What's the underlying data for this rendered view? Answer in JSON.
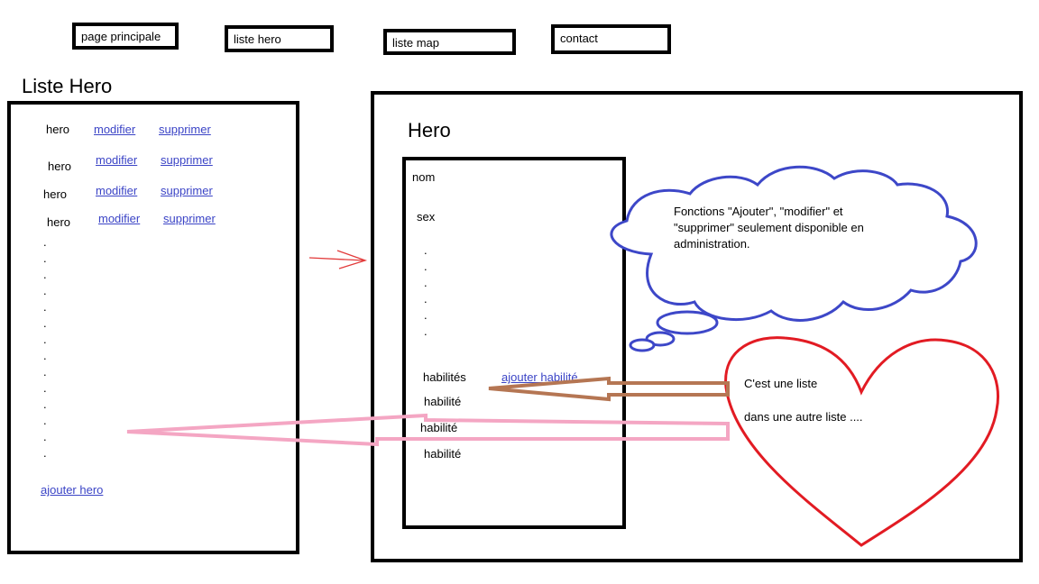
{
  "nav": [
    {
      "label": "page principale"
    },
    {
      "label": "liste hero"
    },
    {
      "label": "liste map"
    },
    {
      "label": "contact"
    }
  ],
  "left": {
    "title": "Liste Hero",
    "rows": [
      {
        "name": "hero",
        "edit": "modifier",
        "del": "supprimer"
      },
      {
        "name": "hero",
        "edit": "modifier",
        "del": "supprimer"
      },
      {
        "name": "hero",
        "edit": "modifier",
        "del": "supprimer"
      },
      {
        "name": "hero",
        "edit": "modifier",
        "del": "supprimer"
      }
    ],
    "add_link": "ajouter hero"
  },
  "right": {
    "title": "Hero",
    "fields": {
      "nom": "nom",
      "sex": "sex"
    },
    "abilities_label": "habilités",
    "add_ability_link": "ajouter habilité",
    "ability_items": [
      "habilité",
      "habilité",
      "habilité"
    ]
  },
  "cloud_text": "Fonctions \"Ajouter\", \"modifier\" et \"supprimer\" seulement disponible en administration.",
  "heart": {
    "line1": "C'est une liste",
    "line2": "dans une autre liste ...."
  },
  "colors": {
    "link": "#3b44c6",
    "cloud": "#3d47c8",
    "heart": "#e21b23",
    "brown_arrow": "#b57653",
    "pink_arrow": "#f4a6c3",
    "red_arrow": "#e23a3a"
  }
}
